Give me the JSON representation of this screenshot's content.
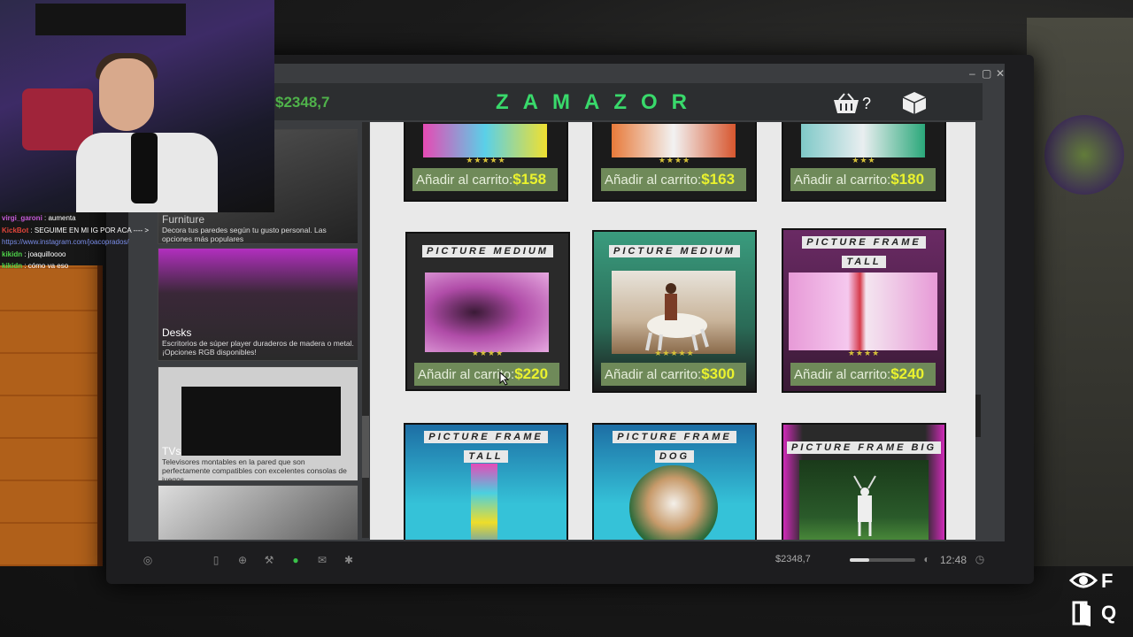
{
  "window": {
    "controls": [
      "–",
      "▢",
      "✕"
    ]
  },
  "header": {
    "balance": "$2348,7",
    "brand": "ZAMAZOR",
    "cart_count": "?",
    "cart_icon": "basket-icon",
    "box_icon": "package-icon"
  },
  "sidebar": {
    "categories": [
      {
        "title": "Furniture",
        "description": "Decora tus paredes según tu gusto personal. Las opciones más populares"
      },
      {
        "title": "Desks",
        "description": "Escritorios de súper player duraderos de madera o metal. ¡Opciones RGB disponibles!"
      },
      {
        "title": "TVs",
        "description": "Televisores montables en la pared que son perfectamente compatibles con excelentes consolas de juegos"
      },
      {
        "title": "",
        "description": ""
      }
    ]
  },
  "products": {
    "button_label": "Añadir al carrito:",
    "items": [
      {
        "label": "",
        "label2": "",
        "price": "$158",
        "stars": "★★★★★"
      },
      {
        "label": "",
        "label2": "",
        "price": "$163",
        "stars": "★★★★"
      },
      {
        "label": "",
        "label2": "",
        "price": "$180",
        "stars": "★★★"
      },
      {
        "label": "PICTURE MEDIUM",
        "label2": "",
        "price": "$220",
        "stars": "★★★★"
      },
      {
        "label": "PICTURE MEDIUM",
        "label2": "",
        "price": "$300",
        "stars": "★★★★★"
      },
      {
        "label": "PICTURE FRAME",
        "label2": "TALL",
        "price": "$240",
        "stars": "★★★★"
      },
      {
        "label": "PICTURE FRAME",
        "label2": "TALL",
        "price": "",
        "stars": ""
      },
      {
        "label": "PICTURE FRAME",
        "label2": "DOG",
        "price": "",
        "stars": ""
      },
      {
        "label": "PICTURE FRAME BIG",
        "label2": "",
        "price": "",
        "stars": ""
      }
    ]
  },
  "taskbar": {
    "money": "$2348,7",
    "time": "12:48",
    "volume": 0.3,
    "icons": [
      "start-icon",
      "phone-icon",
      "globe-icon",
      "wrench-icon",
      "money-icon",
      "mail-icon",
      "settings-icon"
    ]
  },
  "chat": [
    {
      "user": "virgi_garoni",
      "user_color": "#c65ad8",
      "message": "aumenta"
    },
    {
      "user": "KickBot",
      "user_color": "#e0453a",
      "message": "SEGUIME EN MI IG POR ACA ---- >"
    },
    {
      "user": "",
      "user_color": "#7a8de8",
      "message": "https://www.instagram.com/joacoprados/"
    },
    {
      "user": "kikidn",
      "user_color": "#4fd24a",
      "message": "joaquilloooo"
    },
    {
      "user": "kikidn",
      "user_color": "#4fd24a",
      "message": "cómo va eso"
    }
  ],
  "key_hints": [
    {
      "icon": "eye-icon",
      "key": "F"
    },
    {
      "icon": "exit-door-icon",
      "key": "Q"
    }
  ]
}
